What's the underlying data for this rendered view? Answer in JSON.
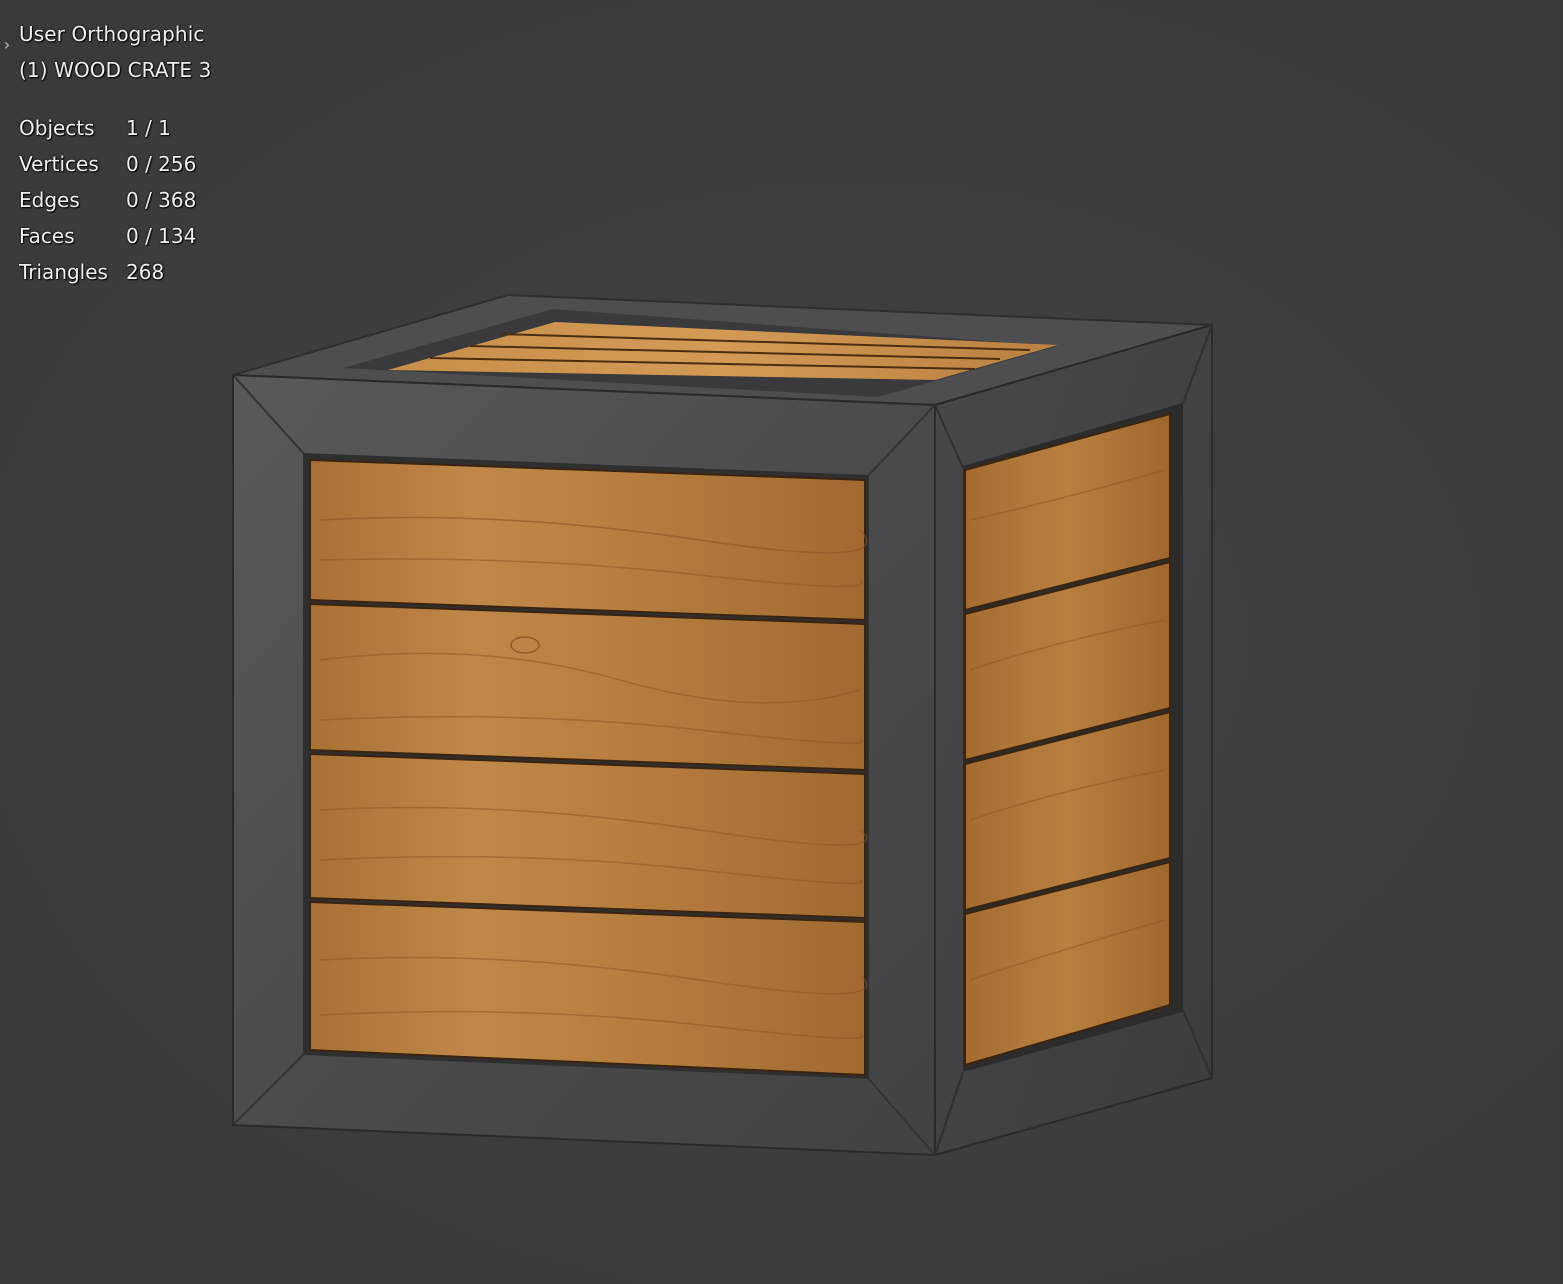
{
  "viewport": {
    "view_name": "User Orthographic",
    "object_name": "(1) WOOD CRATE 3",
    "background_color": "#3d3d3d",
    "sidebar_toggle_icon": "chevron-right-icon"
  },
  "stats": [
    {
      "label": "Objects",
      "value": "1 / 1"
    },
    {
      "label": "Vertices",
      "value": "0 / 256"
    },
    {
      "label": "Edges",
      "value": "0 / 368"
    },
    {
      "label": "Faces",
      "value": "0 / 134"
    },
    {
      "label": "Triangles",
      "value": "268"
    }
  ],
  "crate": {
    "metal_color": "#4a4a4c",
    "wood_color": "#b07a3a",
    "front_planks": 4,
    "side_planks": 4,
    "top_planks": 4
  }
}
